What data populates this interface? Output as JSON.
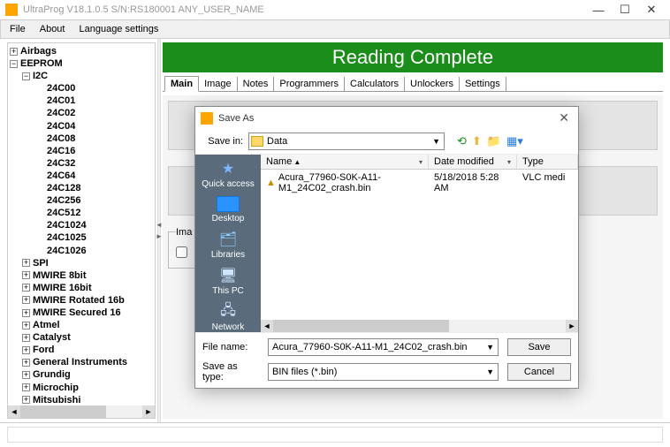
{
  "window": {
    "title": "UltraProg V18.1.0.5 S/N:RS180001 ANY_USER_NAME",
    "min": "—",
    "max": "☐",
    "close": "✕"
  },
  "menu": {
    "file": "File",
    "about": "About",
    "lang": "Language settings"
  },
  "banner": "Reading  Complete",
  "tabs": {
    "main": "Main",
    "image": "Image",
    "notes": "Notes",
    "programmers": "Programmers",
    "calculators": "Calculators",
    "unlockers": "Unlockers",
    "settings": "Settings"
  },
  "image_box_legend": "Ima",
  "tree": {
    "airbags": "Airbags",
    "eeprom": "EEPROM",
    "i2c": "I2C",
    "i2c_items": [
      "24C00",
      "24C01",
      "24C02",
      "24C04",
      "24C08",
      "24C16",
      "24C32",
      "24C64",
      "24C128",
      "24C256",
      "24C512",
      "24C1024",
      "24C1025",
      "24C1026"
    ],
    "rest": [
      "SPI",
      "MWIRE 8bit",
      "MWIRE 16bit",
      "MWIRE Rotated 16b",
      "MWIRE Secured 16",
      "Atmel",
      "Catalyst",
      "Ford",
      "General Instruments",
      "Grundig",
      "Microchip",
      "Mitsubishi"
    ]
  },
  "saveas": {
    "title": "Save As",
    "savein_label": "Save in:",
    "savein_value": "Data",
    "cols": {
      "name": "Name",
      "date": "Date modified",
      "type": "Type"
    },
    "rows": [
      {
        "name": "Acura_77960-S0K-A11-M1_24C02_crash.bin",
        "date": "5/18/2018 5:28 AM",
        "type": "VLC medi"
      }
    ],
    "places": {
      "quick": "Quick access",
      "desktop": "Desktop",
      "libraries": "Libraries",
      "thispc": "This PC",
      "network": "Network"
    },
    "filename_label": "File name:",
    "filename_value": "Acura_77960-S0K-A11-M1_24C02_crash.bin",
    "filetype_label": "Save as type:",
    "filetype_value": "BIN files (*.bin)",
    "save_btn": "Save",
    "cancel_btn": "Cancel"
  }
}
